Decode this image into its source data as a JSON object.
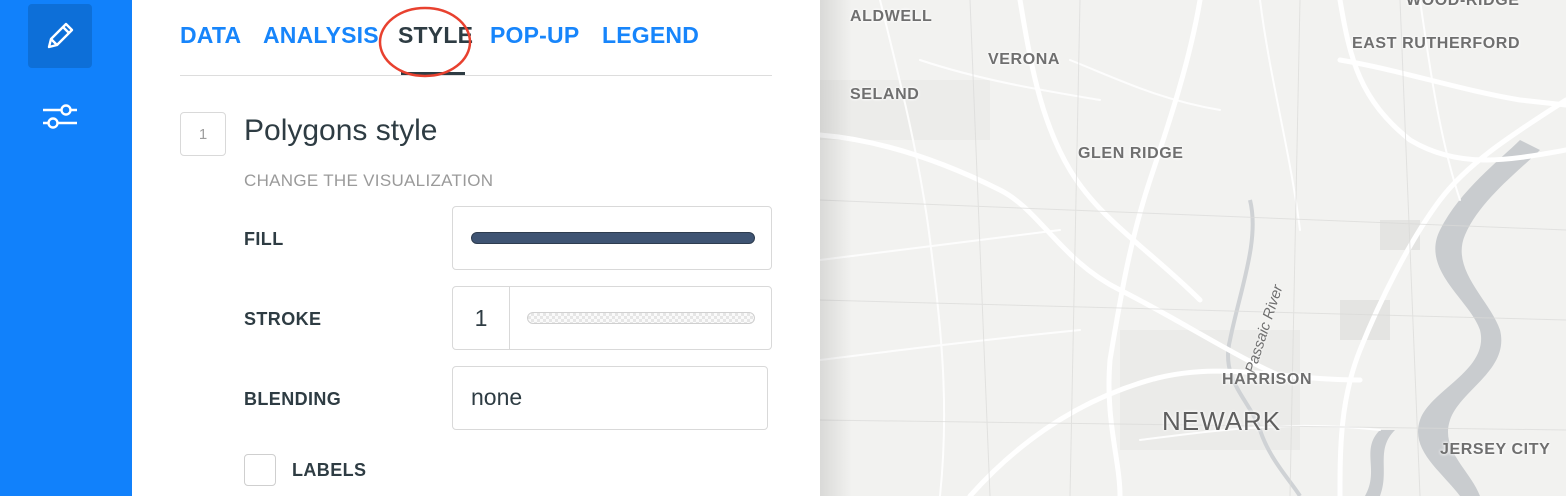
{
  "rail": {
    "items": [
      {
        "icon": "pencil-icon",
        "active": true
      },
      {
        "icon": "sliders-icon",
        "active": false
      }
    ]
  },
  "tabs": [
    {
      "label": "DATA"
    },
    {
      "label": "ANALYSIS"
    },
    {
      "label": "STYLE",
      "active": true
    },
    {
      "label": "POP-UP"
    },
    {
      "label": "LEGEND"
    }
  ],
  "section": {
    "number": "1",
    "title": "Polygons style",
    "subtitle": "CHANGE THE VISUALIZATION"
  },
  "fields": {
    "fill_label": "FILL",
    "fill_color": "#3f5473",
    "stroke_label": "STROKE",
    "stroke_value": "1",
    "blending_label": "BLENDING",
    "blending_value": "none",
    "labels_label": "LABELS"
  },
  "map": {
    "labels": {
      "caldwell": "ALDWELL",
      "wood_ridge": "WOOD-RIDGE",
      "east_rutherford": "EAST RUTHERFORD",
      "verona": "VERONA",
      "roseland": "SELAND",
      "glen_ridge": "GLEN RIDGE",
      "passaic_river": "Passaic River",
      "harrison": "HARRISON",
      "newark": "NEWARK",
      "jersey_city": "JERSEY CITY"
    }
  },
  "colors": {
    "accent": "#1181fb",
    "tab_text": "#1785fb",
    "annotation_circle": "#e8412f"
  }
}
